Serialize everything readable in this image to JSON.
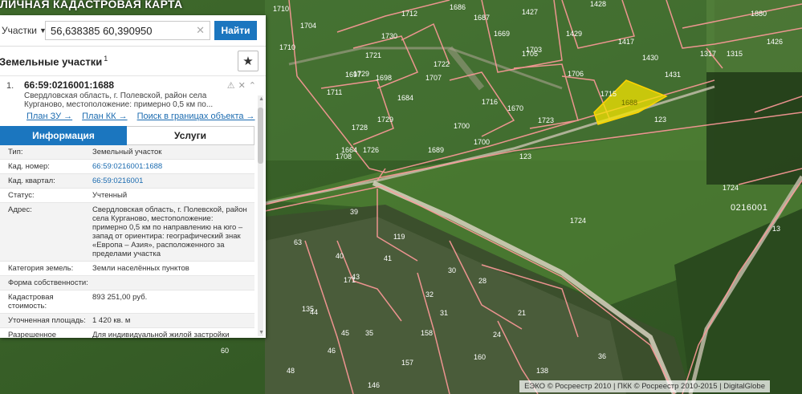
{
  "map": {
    "title": "ЛИЧНАЯ КАДАСТРОВАЯ КАРТА",
    "highlight_label": "1688",
    "quarter_label": "0216001",
    "parcel_labels": [
      "1710",
      "1712",
      "1686",
      "1687",
      "1427",
      "1428",
      "1704",
      "1730",
      "1729",
      "1669",
      "1703",
      "1429",
      "1417",
      "1880",
      "1710",
      "1721",
      "1722",
      "1697",
      "1705",
      "1430",
      "1426",
      "1315",
      "1698",
      "1707",
      "1684",
      "1706",
      "1431",
      "1317",
      "1711",
      "1716",
      "1670",
      "1715",
      "1729",
      "1664",
      "1723",
      "123",
      "1728",
      "1700",
      "1726",
      "1700",
      "1708",
      "1689",
      "123",
      "1724",
      "1724",
      "13",
      "39",
      "119",
      "63",
      "40",
      "41",
      "30",
      "28",
      "43",
      "171",
      "60",
      "44",
      "32",
      "31",
      "21",
      "135",
      "35",
      "158",
      "24",
      "45",
      "46",
      "48",
      "157",
      "146",
      "160",
      "138",
      "36"
    ]
  },
  "search": {
    "type_label": "Участки",
    "query": "56,638385 60,390950",
    "find_label": "Найти"
  },
  "list": {
    "title": "Земельные участки",
    "count": "1",
    "item": {
      "index": "1.",
      "number": "66:59:0216001:1688",
      "address": "Свердловская область, г. Полевской, район села Курганово, местоположение: примерно 0,5 км по...",
      "links": [
        "План ЗУ →",
        "План КК →",
        "Поиск в границах объекта →"
      ]
    }
  },
  "tabs": [
    "Информация",
    "Услуги"
  ],
  "properties": [
    {
      "k": "Тип:",
      "v": "Земельный участок"
    },
    {
      "k": "Кад. номер:",
      "v": "66:59:0216001:1688"
    },
    {
      "k": "Кад. квартал:",
      "v": "66:59:0216001"
    },
    {
      "k": "Статус:",
      "v": "Учтенный"
    },
    {
      "k": "Адрес:",
      "v": "Свердловская область, г. Полевской, район села Курганово, местоположение: примерно 0,5 км по направлению на юго – запад от ориентира: географический знак «Европа – Азия», расположенного за пределами участка"
    },
    {
      "k": "Категория земель:",
      "v": "Земли населённых пунктов"
    },
    {
      "k": "Форма собственности:",
      "v": ""
    },
    {
      "k": "Кадастровая стоимость:",
      "v": "893 251,00 руб."
    },
    {
      "k": "Уточненная площадь:",
      "v": "1 420 кв. м"
    },
    {
      "k": "Разрешенное",
      "v": "Для индивидуальной жилой застройки"
    }
  ],
  "footer": {
    "credit": "ЕЭКО © Росреестр 2010 | ПКК © Росреестр 2010-2015 | DigitalGlobe"
  },
  "colors": {
    "accent": "#1b76bf",
    "parcel_border": "#ff9a9a",
    "highlight_fill": "#f5e600"
  }
}
